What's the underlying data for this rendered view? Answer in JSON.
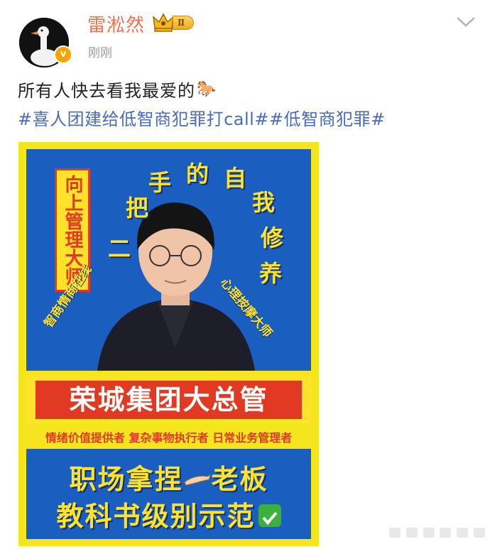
{
  "post": {
    "author": {
      "name": "雷淞然",
      "avatar_icon": "goose-avatar",
      "verified_badge": "v",
      "member_level": "Ⅱ"
    },
    "timestamp": "刚刚",
    "text": "所有人快去看我最爱的",
    "text_emoji": "horse-icon",
    "hashtags": [
      "#喜人团建给低智商犯罪打call#",
      "#低智商犯罪#"
    ],
    "menu_icon": "chevron-down-icon"
  },
  "poster": {
    "vertical_label": "向上管理大师",
    "arc_top": [
      "把",
      "手",
      "的",
      "自",
      "我",
      "修",
      "养"
    ],
    "arc_left_first": "二",
    "arc_small_left": "智商情商在线",
    "arc_small_right": "心理按摩大师",
    "title": "荣城集团大总管",
    "subtitle": "情绪价值提供者 复杂事物执行者 日常业务管理者",
    "line1_a": "职场拿捏",
    "line1_b": "老板",
    "line2": "教科书级别示范",
    "colors": {
      "blue": "#1a5ec0",
      "yellow": "#ffe22a",
      "red": "#e23a22"
    }
  }
}
